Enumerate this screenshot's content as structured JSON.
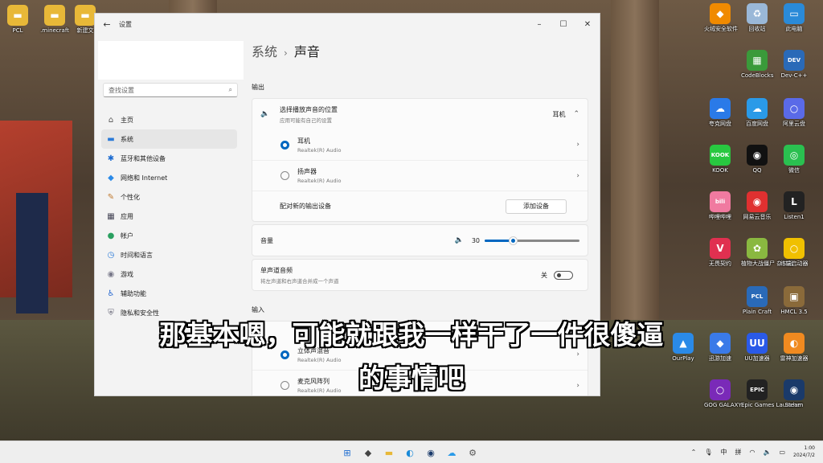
{
  "desktop_icons": [
    {
      "label": "PCL",
      "glyph": "▬",
      "color": "#e8b838"
    },
    {
      "label": ".minecraft",
      "glyph": "▬",
      "color": "#e8b838"
    },
    {
      "label": "新建文",
      "glyph": "▬",
      "color": "#e8b838"
    },
    {
      "label": "火绒安全软件",
      "glyph": "◆",
      "color": "#f08a00"
    },
    {
      "label": "回收站",
      "glyph": "♻",
      "color": "#9ab8d8"
    },
    {
      "label": "此电脑",
      "glyph": "▭",
      "color": "#2a8ad8"
    },
    {
      "label": "CodeBlocks",
      "glyph": "▦",
      "color": "#3a9a3a"
    },
    {
      "label": "Dev-C++",
      "glyph": "DEV",
      "color": "#2a6ab8"
    },
    {
      "label": "夸克网盘",
      "glyph": "☁",
      "color": "#2a7ae8"
    },
    {
      "label": "百度网盘",
      "glyph": "☁",
      "color": "#2a9ae8"
    },
    {
      "label": "阿里云盘",
      "glyph": "○",
      "color": "#5a6ae8"
    },
    {
      "label": "KOOK",
      "glyph": "KOOK",
      "color": "#28c840"
    },
    {
      "label": "QQ",
      "glyph": "◉",
      "color": "#111111"
    },
    {
      "label": "微信",
      "glyph": "◎",
      "color": "#2ac050"
    },
    {
      "label": "哔哩哔哩",
      "glyph": "bili",
      "color": "#f07aa0"
    },
    {
      "label": "网易云音乐",
      "glyph": "◉",
      "color": "#e03030"
    },
    {
      "label": "Listen1",
      "glyph": "L",
      "color": "#222222"
    },
    {
      "label": "无畏契约",
      "glyph": "V",
      "color": "#e03050"
    },
    {
      "label": "植物大战僵尸 杂交版",
      "glyph": "✿",
      "color": "#8ab840"
    },
    {
      "label": "终端启动器",
      "glyph": "○",
      "color": "#f0c000"
    },
    {
      "label": "Plain Craft",
      "glyph": "PCL",
      "color": "#2a6ab8"
    },
    {
      "label": "HMCL 3.5",
      "glyph": "▣",
      "color": "#8a6a3a"
    },
    {
      "label": "OurPlay",
      "glyph": "▲",
      "color": "#2a8ae8"
    },
    {
      "label": "迅游加速",
      "glyph": "◆",
      "color": "#3a7ae8"
    },
    {
      "label": "UU加速器",
      "glyph": "UU",
      "color": "#2a5ae8"
    },
    {
      "label": "雷神加速器",
      "glyph": "◐",
      "color": "#f08a20"
    },
    {
      "label": "GOG GALAXY",
      "glyph": "○",
      "color": "#7a2ab8"
    },
    {
      "label": "Epic Games Launcher",
      "glyph": "EPIC",
      "color": "#222222"
    },
    {
      "label": "Steam",
      "glyph": "◉",
      "color": "#1a3a6a"
    }
  ],
  "window": {
    "title": "设置",
    "back_glyph": "←",
    "min_glyph": "–",
    "max_glyph": "☐",
    "close_glyph": "✕"
  },
  "sidebar": {
    "search_placeholder": "查找设置",
    "search_glyph": "⌕",
    "items": [
      {
        "label": "主页",
        "glyph": "⌂",
        "color": "#555"
      },
      {
        "label": "系统",
        "glyph": "▬",
        "color": "#2a7ad8"
      },
      {
        "label": "蓝牙和其他设备",
        "glyph": "✱",
        "color": "#1a6ad0"
      },
      {
        "label": "网络和 Internet",
        "glyph": "◆",
        "color": "#2a8ae8"
      },
      {
        "label": "个性化",
        "glyph": "✎",
        "color": "#c07a30"
      },
      {
        "label": "应用",
        "glyph": "▦",
        "color": "#445"
      },
      {
        "label": "帐户",
        "glyph": "●",
        "color": "#2aa060"
      },
      {
        "label": "时间和语言",
        "glyph": "◷",
        "color": "#2a7ad8"
      },
      {
        "label": "游戏",
        "glyph": "◉",
        "color": "#778"
      },
      {
        "label": "辅助功能",
        "glyph": "♿",
        "color": "#2a6ad0"
      },
      {
        "label": "隐私和安全性",
        "glyph": "⛨",
        "color": "#667"
      }
    ]
  },
  "main": {
    "breadcrumb_parent": "系统",
    "breadcrumb_sep": "›",
    "breadcrumb_current": "声音",
    "output_header": "输出",
    "choose_output_title": "选择播放声音的位置",
    "choose_output_sub": "应用可能有自己的设置",
    "choose_output_value": "耳机",
    "speaker_glyph": "🔈",
    "up_chevron": "⌃",
    "right_chevron": "›",
    "devices": [
      {
        "name": "耳机",
        "sub": "Realtek(R) Audio",
        "selected": true
      },
      {
        "name": "扬声器",
        "sub": "Realtek(R) Audio",
        "selected": false
      }
    ],
    "pair_label": "配对新的输出设备",
    "pair_button": "添加设备",
    "volume_label": "音量",
    "volume_value": "30",
    "mono_title": "单声道音频",
    "mono_sub": "将左声道和右声道合并成一个声道",
    "mono_state": "关",
    "input_header": "输入",
    "input_devices": [
      {
        "name": "立体声混音",
        "sub": "Realtek(R) Audio",
        "selected": true
      },
      {
        "name": "麦克风阵列",
        "sub": "Realtek(R) Audio",
        "selected": false
      }
    ]
  },
  "subtitle": {
    "line1": "那基本嗯，可能就跟我一样干了一件很傻逼",
    "line2": "的事情吧"
  },
  "taskbar": {
    "apps": [
      {
        "glyph": "⊞",
        "color": "#1a6ad0"
      },
      {
        "glyph": "◆",
        "color": "#444"
      },
      {
        "glyph": "▬",
        "color": "#e8b838"
      },
      {
        "glyph": "◐",
        "color": "#1a8ad8"
      },
      {
        "glyph": "◉",
        "color": "#1a3a6a"
      },
      {
        "glyph": "☁",
        "color": "#2a9ae8"
      },
      {
        "glyph": "⚙",
        "color": "#555"
      }
    ],
    "tray_chevron": "⌃",
    "mic_glyph": "🎙",
    "ime": "中",
    "ime2": "拼",
    "wifi_glyph": "◠",
    "sound_glyph": "🔈",
    "battery_glyph": "▭",
    "time": "1:00",
    "date": "2024/7/2"
  }
}
